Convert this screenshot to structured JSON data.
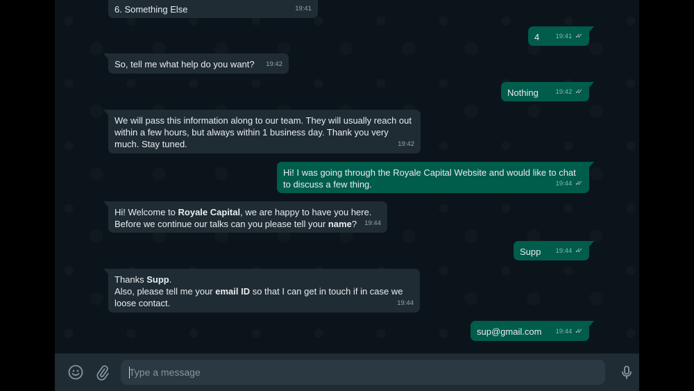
{
  "chat": {
    "messages": [
      {
        "id": "m1",
        "direction": "in",
        "text": "6. Something Else",
        "time": "19:41"
      },
      {
        "id": "m2",
        "direction": "out",
        "text": "4",
        "time": "19:41",
        "status": "read"
      },
      {
        "id": "m3",
        "direction": "in",
        "text": "So, tell me what help do you want?",
        "time": "19:42"
      },
      {
        "id": "m4",
        "direction": "out",
        "text": "Nothing",
        "time": "19:42",
        "status": "read"
      },
      {
        "id": "m5",
        "direction": "in",
        "text": "We will pass this information along to our team. They will usually reach out within a few hours, but always within 1 business day. Thank you very much. Stay tuned.",
        "time": "19:42"
      },
      {
        "id": "m6",
        "direction": "out",
        "text": "Hi! I was going through the Royale Capital Website and would like to chat to discuss a few thing.",
        "time": "19:44",
        "status": "read"
      },
      {
        "id": "m7",
        "direction": "in",
        "html": "Hi! Welcome to <b>Royale Capital</b>, we are happy to have you here.\nBefore we continue our talks can you please tell your <b>name</b>?",
        "time": "19:44"
      },
      {
        "id": "m8",
        "direction": "out",
        "text": "Supp",
        "time": "19:44",
        "status": "read"
      },
      {
        "id": "m9",
        "direction": "in",
        "html": "Thanks <b>Supp</b>.\nAlso, please tell me your <b>email ID</b> so that I can get in touch if in case we loose contact.",
        "time": "19:44"
      },
      {
        "id": "m10",
        "direction": "out",
        "text": "sup@gmail.com",
        "time": "19:44",
        "status": "read"
      }
    ]
  },
  "compose": {
    "placeholder": "Type a message",
    "emoji_icon": "emoji-icon",
    "attach_icon": "paperclip-icon",
    "mic_icon": "microphone-icon"
  },
  "colors": {
    "background": "#0b141a",
    "incoming_bubble": "#202c33",
    "outgoing_bubble": "#005c4b",
    "text": "#e9edef",
    "meta_text": "#8696a0"
  }
}
